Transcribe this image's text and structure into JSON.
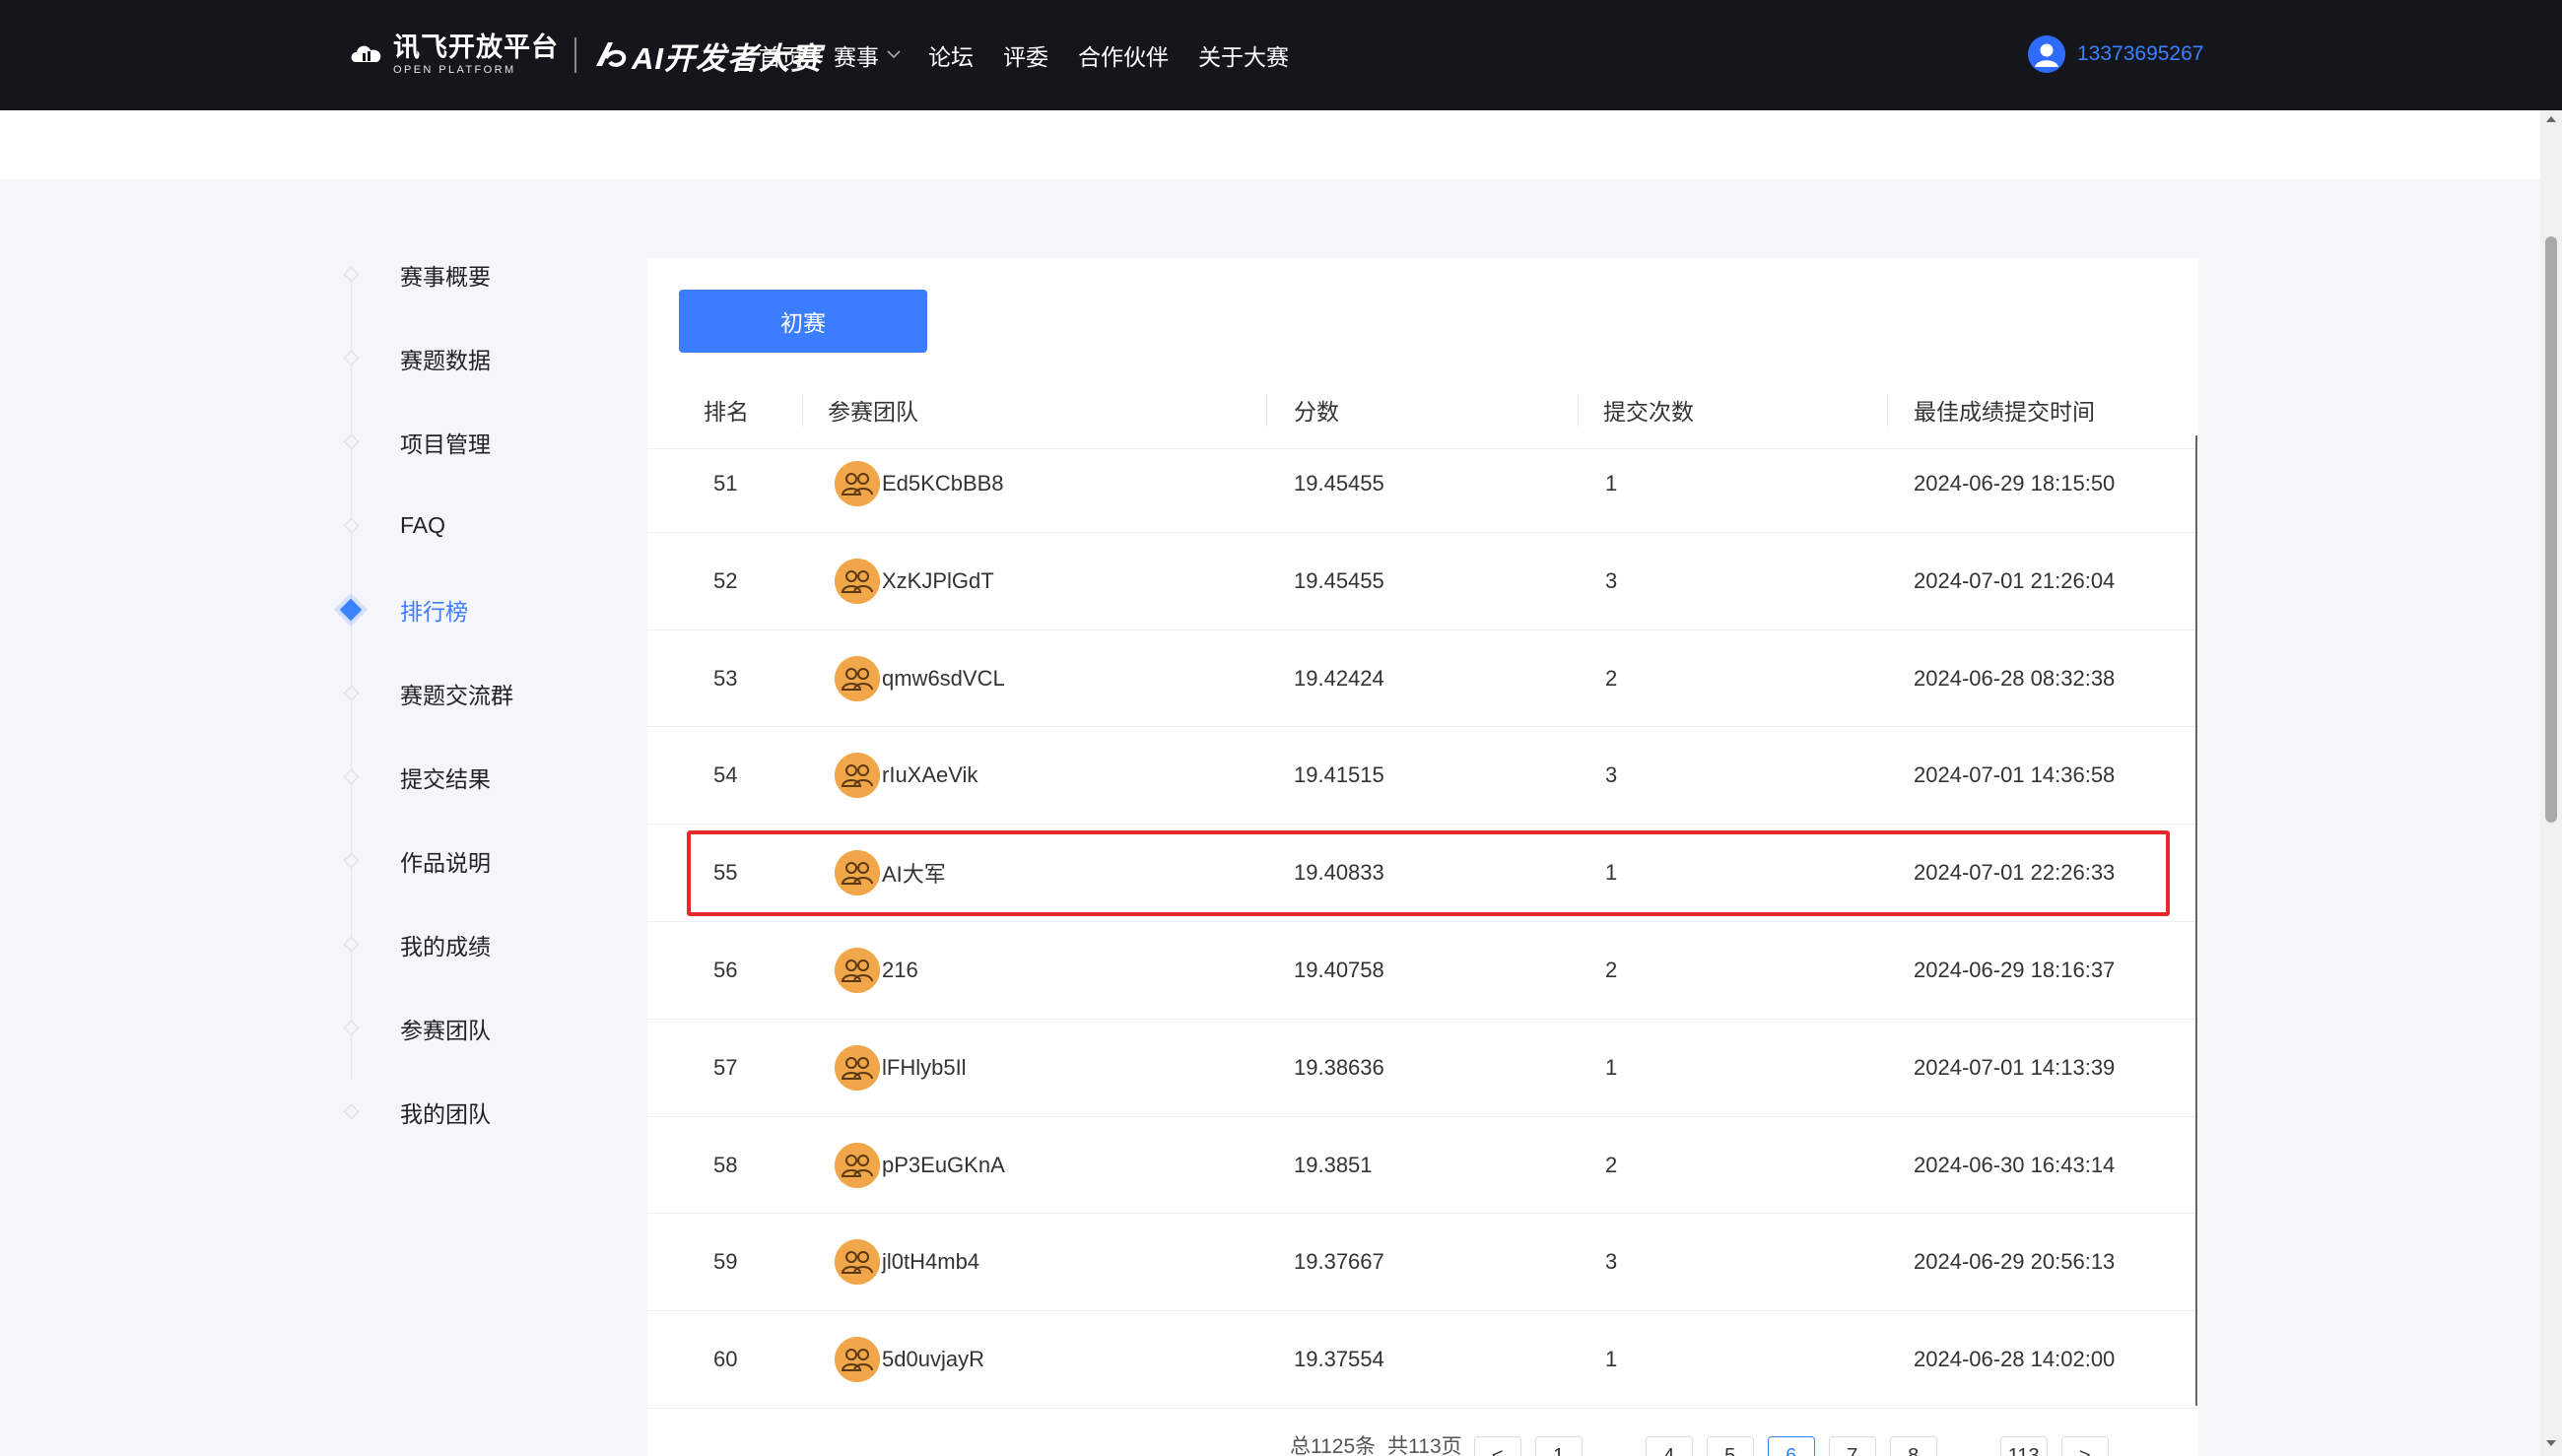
{
  "header": {
    "logo_cn": "讯飞开放平台",
    "logo_en": "OPEN PLATFORM",
    "logo_ai": "AI开发者大赛",
    "nav": [
      {
        "label": "首页",
        "has_dropdown": false
      },
      {
        "label": "赛事",
        "has_dropdown": true
      },
      {
        "label": "论坛",
        "has_dropdown": false
      },
      {
        "label": "评委",
        "has_dropdown": false
      },
      {
        "label": "合作伙伴",
        "has_dropdown": false
      },
      {
        "label": "关于大赛",
        "has_dropdown": false
      }
    ],
    "user_phone": "13373695267"
  },
  "sidebar": {
    "items": [
      {
        "label": "赛事概要",
        "active": false
      },
      {
        "label": "赛题数据",
        "active": false
      },
      {
        "label": "项目管理",
        "active": false
      },
      {
        "label": "FAQ",
        "active": false
      },
      {
        "label": "排行榜",
        "active": true
      },
      {
        "label": "赛题交流群",
        "active": false
      },
      {
        "label": "提交结果",
        "active": false
      },
      {
        "label": "作品说明",
        "active": false
      },
      {
        "label": "我的成绩",
        "active": false
      },
      {
        "label": "参赛团队",
        "active": false
      },
      {
        "label": "我的团队",
        "active": false
      }
    ]
  },
  "leaderboard": {
    "stage_tab": "初赛",
    "columns": {
      "rank": "排名",
      "team": "参赛团队",
      "score": "分数",
      "submissions": "提交次数",
      "best_time": "最佳成绩提交时间"
    },
    "rows": [
      {
        "rank": "51",
        "team": "Ed5KCbBB8",
        "score": "19.45455",
        "submissions": "1",
        "best_time": "2024-06-29 18:15:50"
      },
      {
        "rank": "52",
        "team": "XzKJPlGdT",
        "score": "19.45455",
        "submissions": "3",
        "best_time": "2024-07-01 21:26:04"
      },
      {
        "rank": "53",
        "team": "qmw6sdVCL",
        "score": "19.42424",
        "submissions": "2",
        "best_time": "2024-06-28 08:32:38"
      },
      {
        "rank": "54",
        "team": "rIuXAeVik",
        "score": "19.41515",
        "submissions": "3",
        "best_time": "2024-07-01 14:36:58"
      },
      {
        "rank": "55",
        "team": "AI大军",
        "score": "19.40833",
        "submissions": "1",
        "best_time": "2024-07-01 22:26:33",
        "highlighted": true
      },
      {
        "rank": "56",
        "team": "216",
        "score": "19.40758",
        "submissions": "2",
        "best_time": "2024-06-29 18:16:37"
      },
      {
        "rank": "57",
        "team": "lFHlyb5Il",
        "score": "19.38636",
        "submissions": "1",
        "best_time": "2024-07-01 14:13:39"
      },
      {
        "rank": "58",
        "team": "pP3EuGKnA",
        "score": "19.3851",
        "submissions": "2",
        "best_time": "2024-06-30 16:43:14"
      },
      {
        "rank": "59",
        "team": "jl0tH4mb4",
        "score": "19.37667",
        "submissions": "3",
        "best_time": "2024-06-29 20:56:13"
      },
      {
        "rank": "60",
        "team": "5d0uvjayR",
        "score": "19.37554",
        "submissions": "1",
        "best_time": "2024-06-28 14:02:00"
      }
    ],
    "highlight_color": "#e62a2a"
  },
  "pagination": {
    "total_text": "总1125条",
    "pages_text": "共113页",
    "prev": "<",
    "next": ">",
    "pages": [
      "1",
      "...",
      "4",
      "5",
      "6",
      "7",
      "8",
      "...",
      "113"
    ],
    "current": "6"
  },
  "colors": {
    "nav_bg": "#15161b",
    "accent": "#3b7dff",
    "avatar": "#f2a64a"
  }
}
